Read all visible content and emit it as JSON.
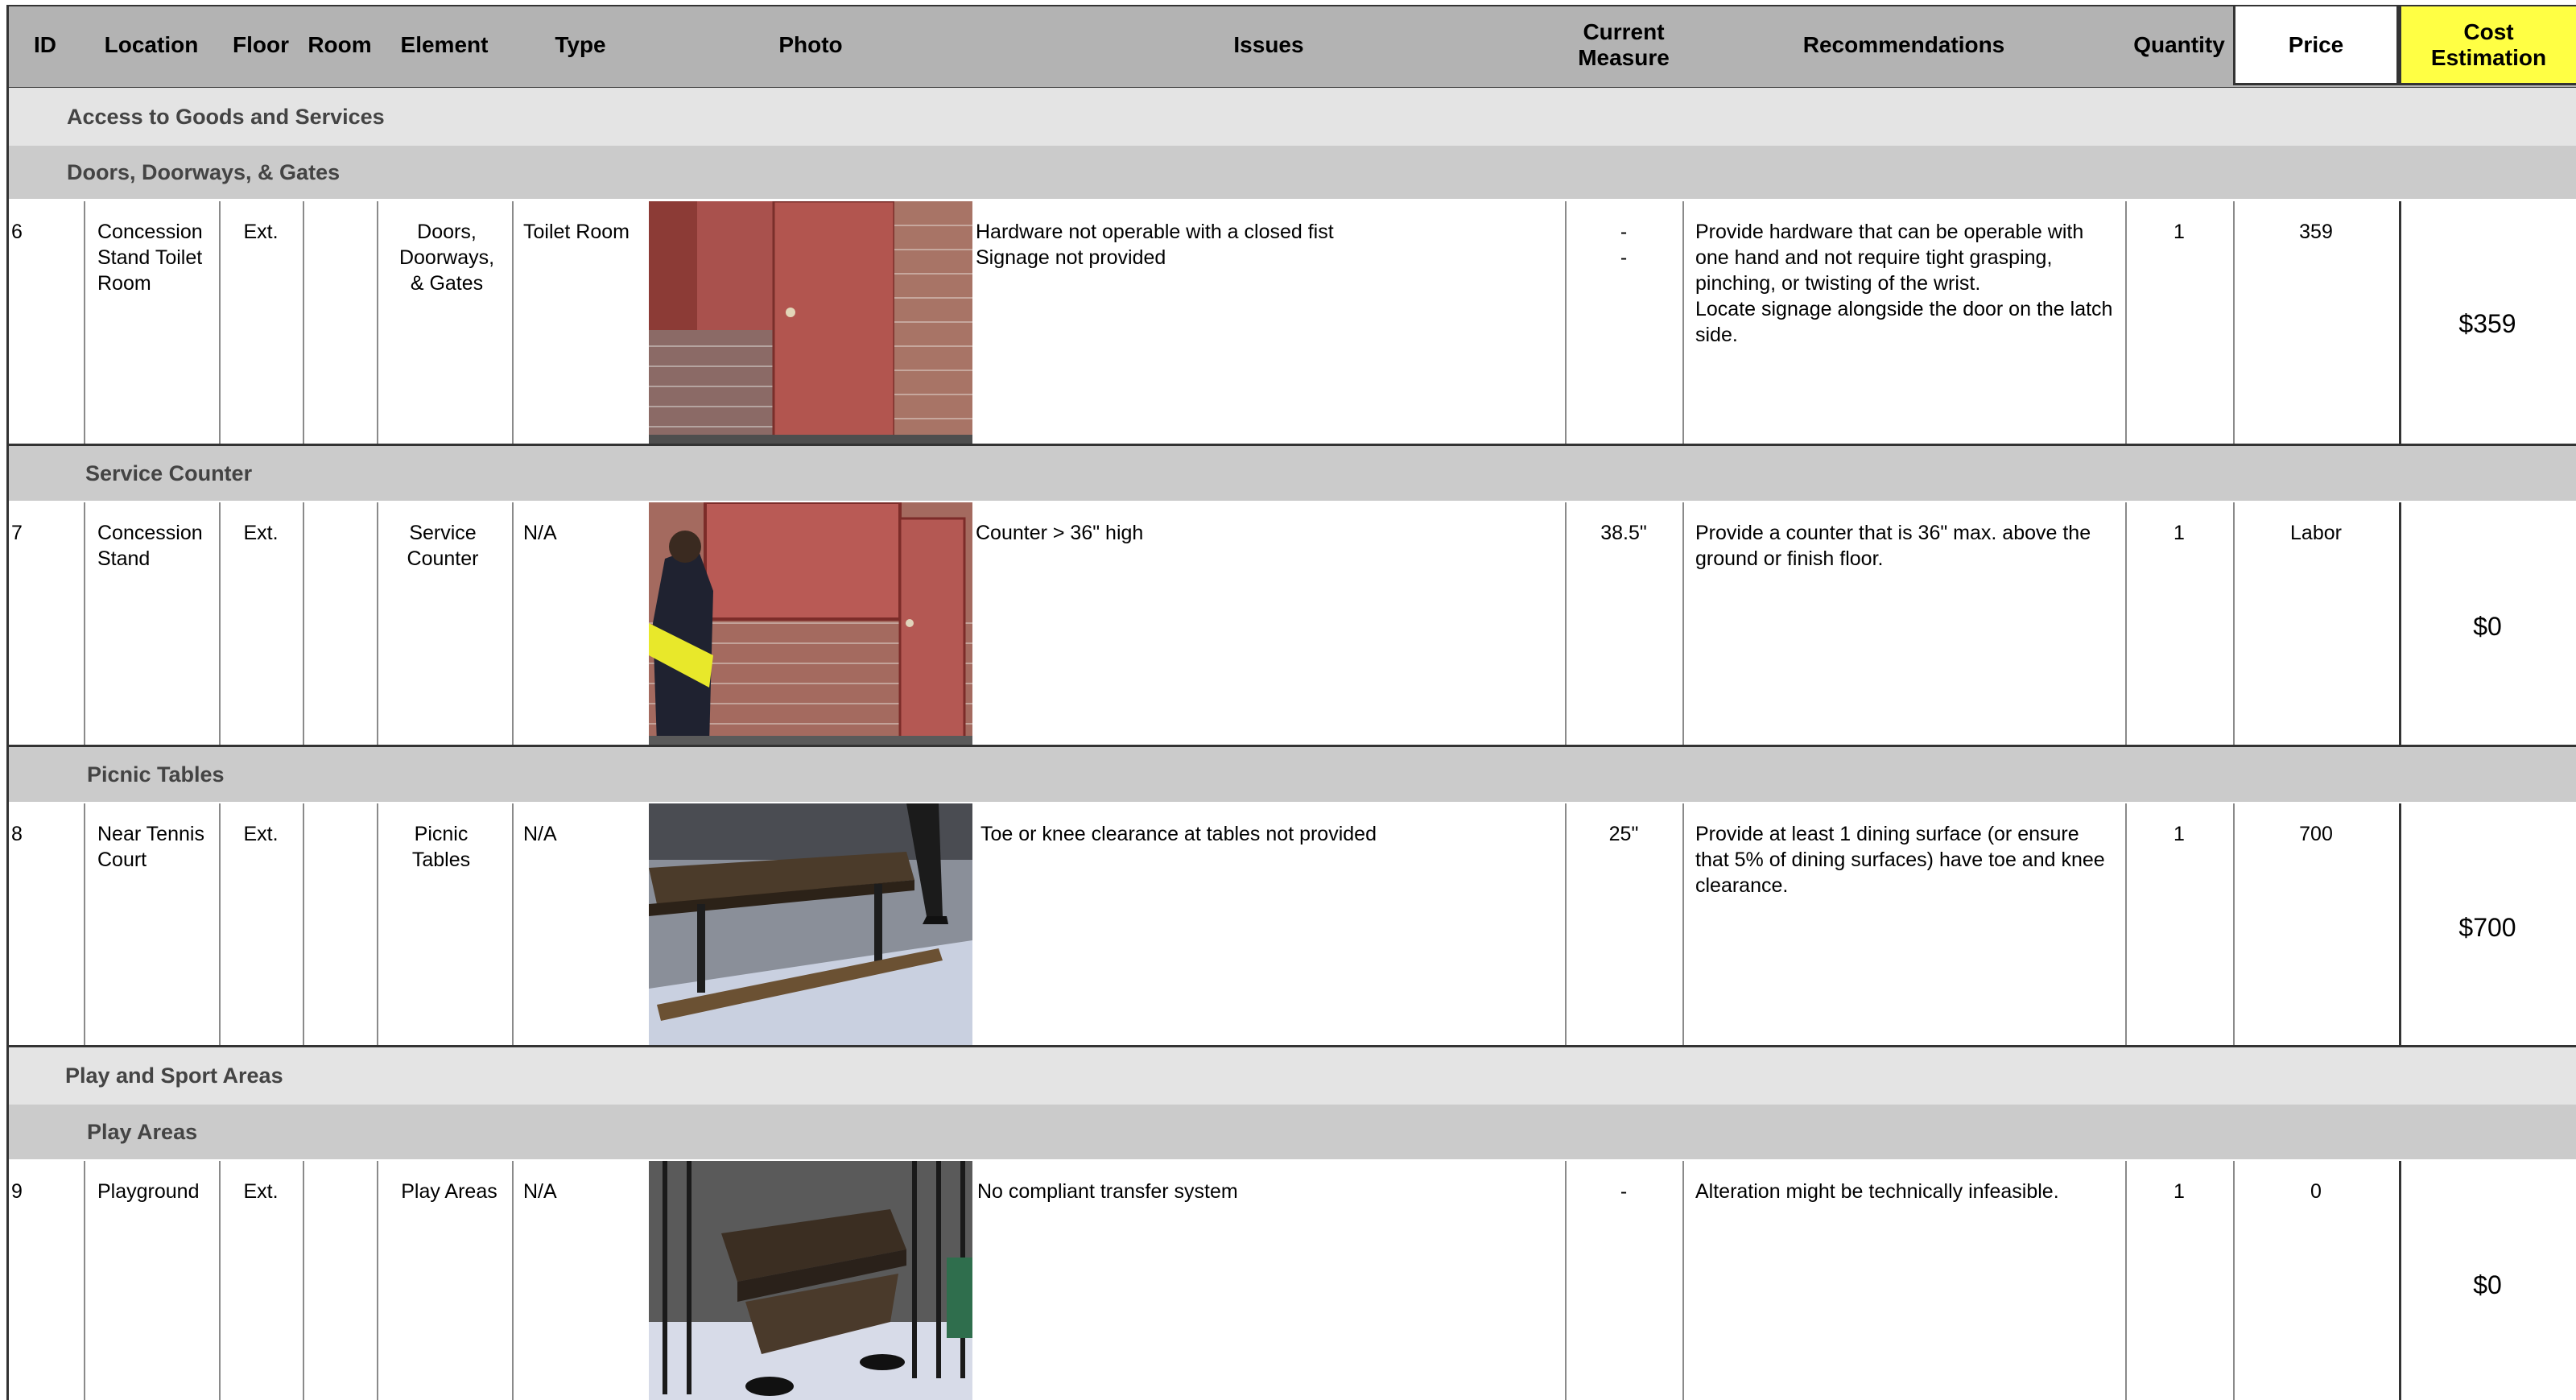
{
  "header": {
    "id": "ID",
    "location": "Location",
    "floor": "Floor",
    "room": "Room",
    "element": "Element",
    "type": "Type",
    "photo": "Photo",
    "issues": "Issues",
    "current_measure": "Current\nMeasure",
    "recommendations": "Recommendations",
    "quantity": "Quantity",
    "price": "Price",
    "cost_estimation": "Cost\nEstimation"
  },
  "sections": {
    "access_goods": "Access to Goods and Services",
    "doors": "Doors, Doorways, & Gates",
    "service_counter": "Service Counter",
    "picnic_tables": "Picnic Tables",
    "play_sport": "Play and Sport Areas",
    "play_areas": "Play Areas"
  },
  "rows": [
    {
      "id": "6",
      "location": "Concession Stand Toilet Room",
      "floor": "Ext.",
      "room": "",
      "element": "Doors, Doorways, & Gates",
      "type": "Toilet Room",
      "photo": "door-photo",
      "issues": "Hardware not operable with a closed fist\nSignage not provided",
      "current_measure": "-\n-",
      "recommendations": "Provide hardware that can be operable with one hand and not require tight grasping, pinching, or twisting of the wrist.\nLocate signage alongside the door on the latch side.",
      "quantity": "1",
      "price": "359",
      "cost": "$359"
    },
    {
      "id": "7",
      "location": "Concession Stand",
      "floor": "Ext.",
      "room": "",
      "element": "Service Counter",
      "type": "N/A",
      "photo": "counter-photo",
      "issues": "Counter > 36\" high",
      "current_measure": "38.5\"",
      "recommendations": "Provide a counter that is 36\" max. above the ground or finish floor.",
      "quantity": "1",
      "price": "Labor",
      "cost": "$0"
    },
    {
      "id": "8",
      "location": "Near Tennis Court",
      "floor": "Ext.",
      "room": "",
      "element": "Picnic Tables",
      "type": "N/A",
      "photo": "picnic-table-photo",
      "issues": "Toe or knee clearance at tables not provided",
      "current_measure": "25\"",
      "recommendations": "Provide at least 1 dining surface (or ensure that 5% of dining surfaces) have toe and knee clearance.",
      "quantity": "1",
      "price": "700",
      "cost": "$700"
    },
    {
      "id": "9",
      "location": "Playground",
      "floor": "Ext.",
      "room": "",
      "element": "Play Areas",
      "type": "N/A",
      "photo": "playground-photo",
      "issues": "No compliant transfer system",
      "current_measure": "-",
      "recommendations": "Alteration might be technically infeasible.",
      "quantity": "1",
      "price": "0",
      "cost": "$0"
    }
  ],
  "colors": {
    "header_bg": "#b3b3b3",
    "cost_header_bg": "#ffff44",
    "category_band": "#e4e4e4",
    "subcategory_band": "#cbcbcb"
  }
}
